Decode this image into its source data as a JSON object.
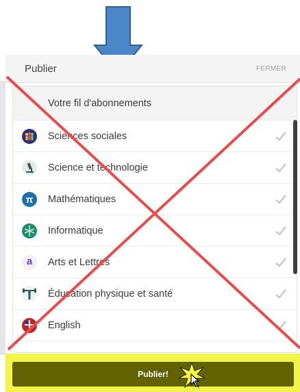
{
  "header": {
    "title": "Publier",
    "close_label": "FERMER"
  },
  "feed_item": {
    "label": "Votre fil d'abonnements"
  },
  "subjects": [
    {
      "label": "Sciences sociales",
      "icon": "people-icon"
    },
    {
      "label": "Science et technologie",
      "icon": "microscope-icon"
    },
    {
      "label": "Mathématiques",
      "icon": "pi-icon",
      "glyph": "π"
    },
    {
      "label": "Informatique",
      "icon": "circuit-icon"
    },
    {
      "label": "Arts et Lettres",
      "icon": "letter-a-icon",
      "glyph": "a"
    },
    {
      "label": "Éducation physique et santé",
      "icon": "weightlifter-icon"
    },
    {
      "label": "English",
      "icon": "flag-globe-icon"
    }
  ],
  "footer": {
    "publish_label": "Publier!"
  },
  "colors": {
    "arrow": "#4a86c8",
    "cross": "#e84b4b",
    "footer_bg": "#f3f34a",
    "button_bg": "#616303"
  }
}
